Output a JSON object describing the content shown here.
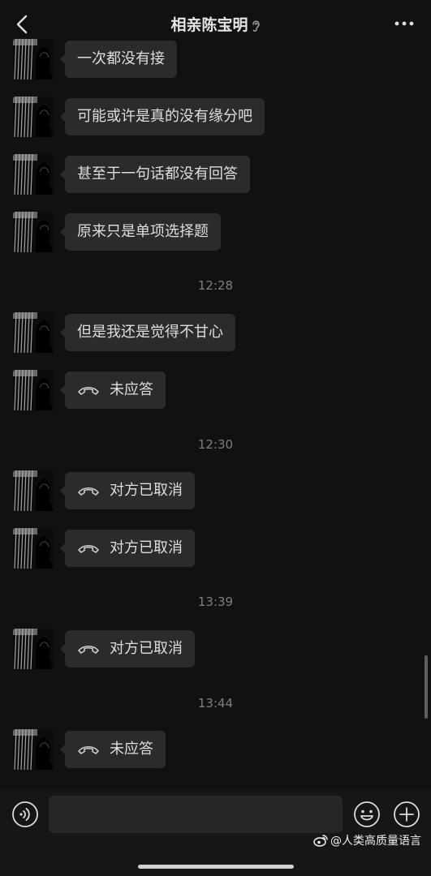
{
  "header": {
    "title": "相亲陈宝明",
    "back_icon": "chevron-left-icon",
    "ear_icon": "ear-icon",
    "more_icon": "more-dots-icon"
  },
  "messages": [
    {
      "type": "text",
      "text": "一次都没有接"
    },
    {
      "type": "text",
      "text": "可能或许是真的没有缘分吧"
    },
    {
      "type": "text",
      "text": "甚至于一句话都没有回答"
    },
    {
      "type": "text",
      "text": "原来只是单项选择题"
    },
    {
      "type": "time",
      "text": "12:28"
    },
    {
      "type": "text",
      "text": "但是我还是觉得不甘心"
    },
    {
      "type": "call",
      "text": "未应答"
    },
    {
      "type": "time",
      "text": "12:30"
    },
    {
      "type": "call",
      "text": "对方已取消"
    },
    {
      "type": "call",
      "text": "对方已取消"
    },
    {
      "type": "time",
      "text": "13:39"
    },
    {
      "type": "call",
      "text": "对方已取消"
    },
    {
      "type": "time",
      "text": "13:44"
    },
    {
      "type": "call",
      "text": "未应答"
    }
  ],
  "input_bar": {
    "voice_icon": "voice-icon",
    "emoji_icon": "emoji-icon",
    "plus_icon": "plus-icon",
    "input_value": ""
  },
  "watermark": {
    "text": "@人类高质量语言",
    "icon": "weibo-icon"
  },
  "colors": {
    "background": "#111111",
    "bubble": "#2b2b2b",
    "text": "#dedede",
    "timestamp": "#7e7e7e"
  }
}
